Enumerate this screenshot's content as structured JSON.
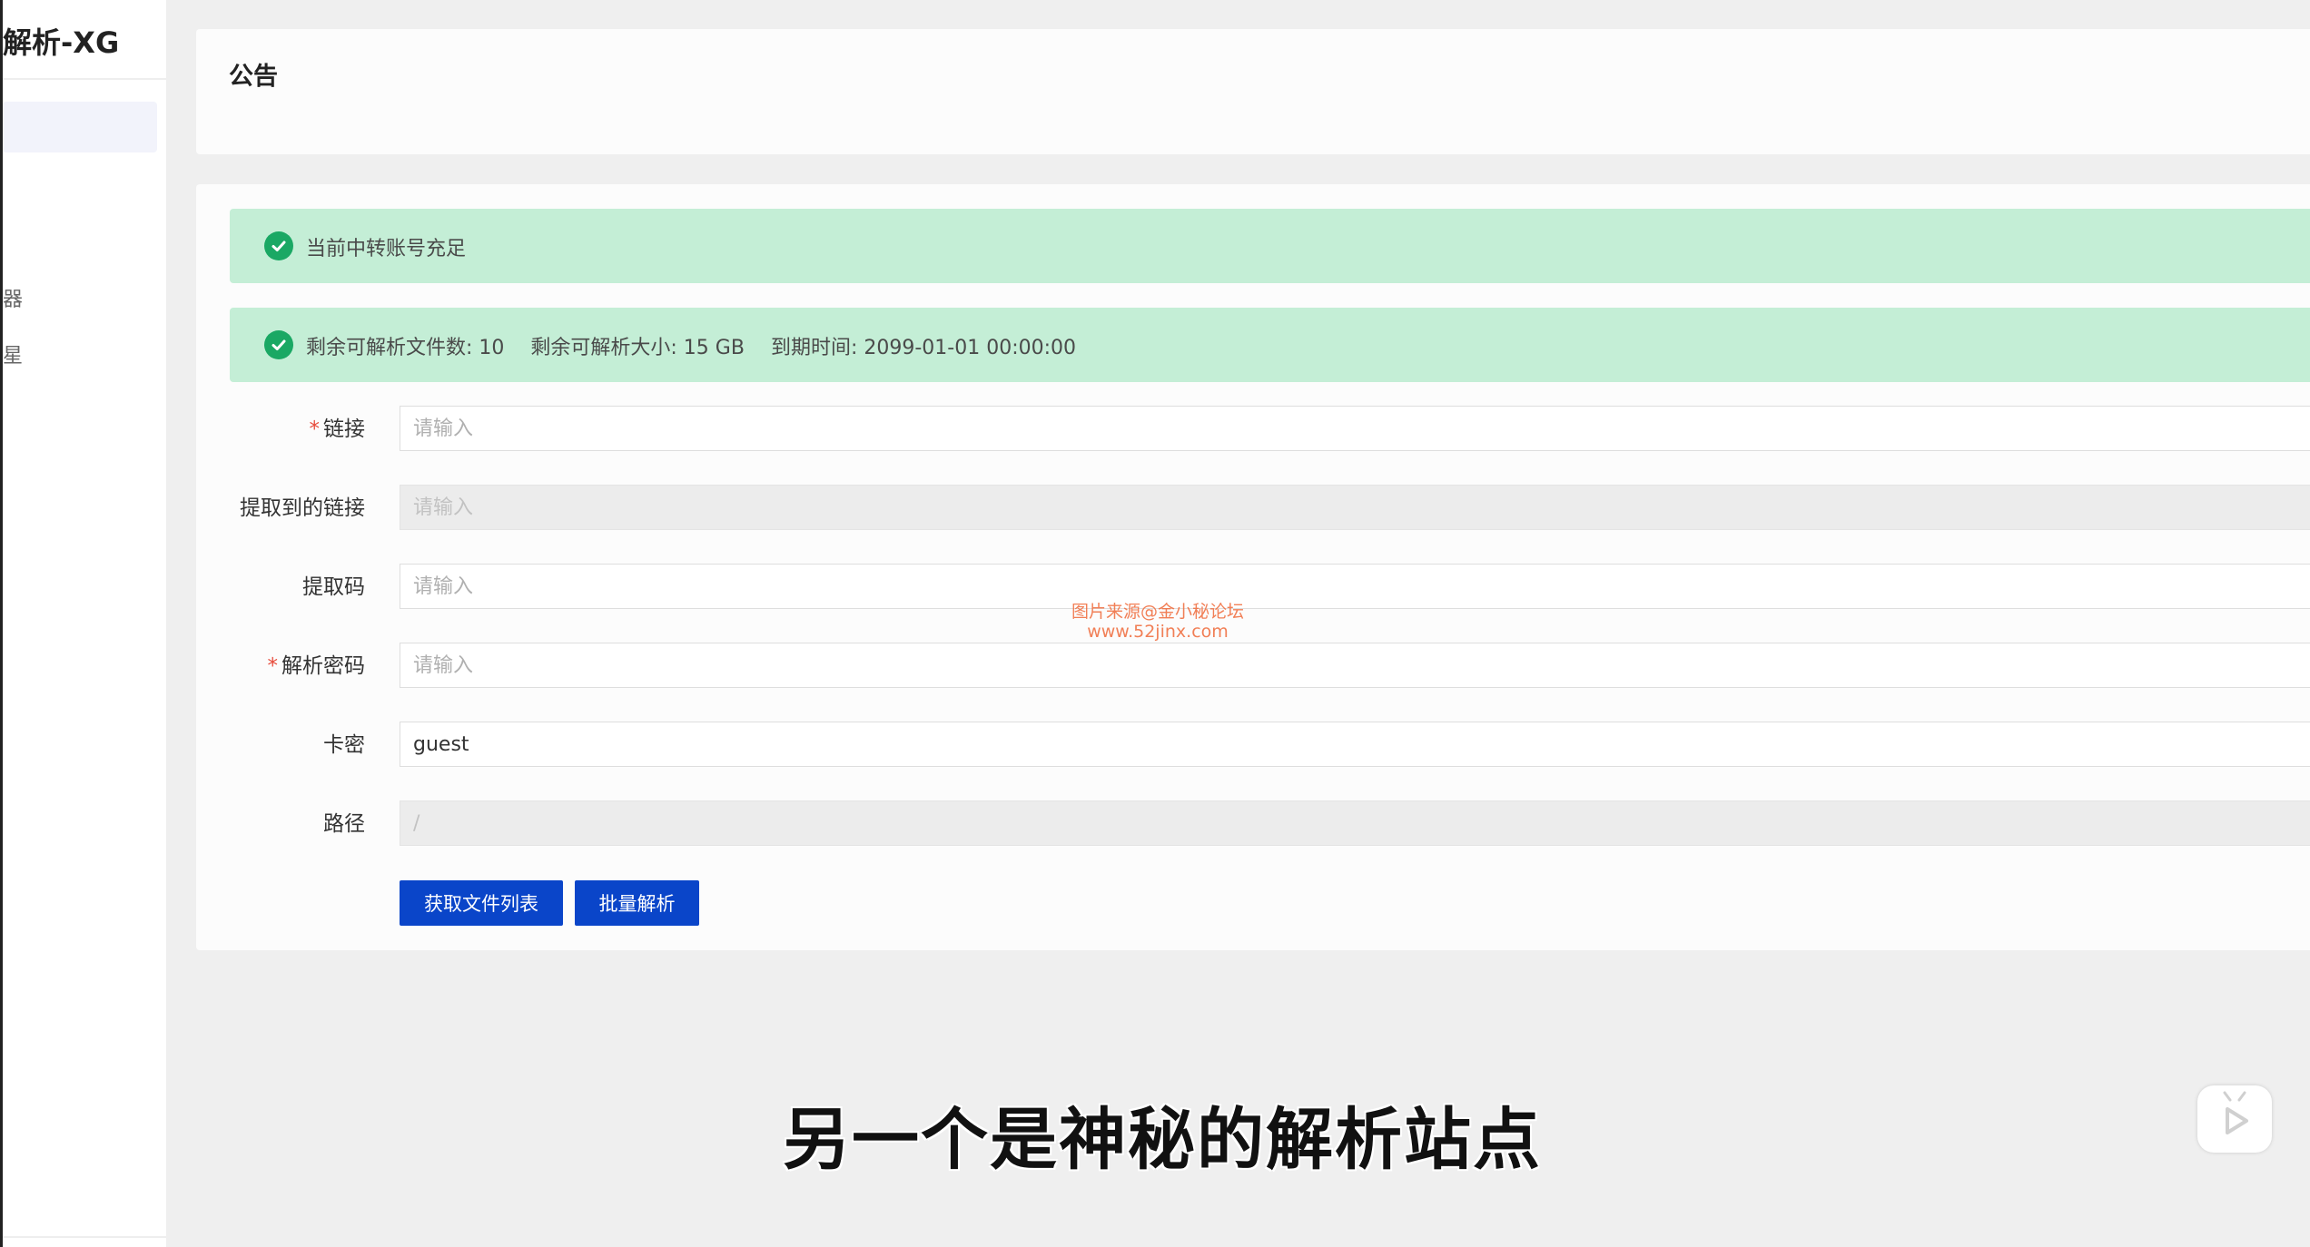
{
  "sidebar": {
    "brand": "解析-XG",
    "items": [
      {
        "label": "器"
      },
      {
        "label": "星"
      }
    ]
  },
  "notice": {
    "title": "公告"
  },
  "alerts": [
    {
      "text": "当前中转账号充足"
    },
    {
      "files_left": "剩余可解析文件数: 10",
      "size_left": "剩余可解析大小: 15 GB",
      "expiry": "到期时间: 2099-01-01 00:00:00"
    }
  ],
  "form": {
    "link": {
      "label": "链接",
      "placeholder": "请输入",
      "required": true
    },
    "extracted_link": {
      "label": "提取到的链接",
      "placeholder": "请输入"
    },
    "extract_code": {
      "label": "提取码",
      "placeholder": "请输入"
    },
    "parse_password": {
      "label": "解析密码",
      "placeholder": "请输入",
      "required": true
    },
    "card_key": {
      "label": "卡密",
      "value": "guest"
    },
    "path": {
      "label": "路径",
      "placeholder": "/"
    }
  },
  "buttons": {
    "get_file_list": "获取文件列表",
    "batch_parse": "批量解析"
  },
  "watermark": {
    "line1": "图片来源@金小秘论坛",
    "line2": "www.52jinx.com"
  },
  "subtitle": "另一个是神秘的解析站点",
  "colors": {
    "primary_button": "#0a45c9",
    "success_alert_bg": "#c4eed6",
    "success_icon": "#1aa864"
  }
}
